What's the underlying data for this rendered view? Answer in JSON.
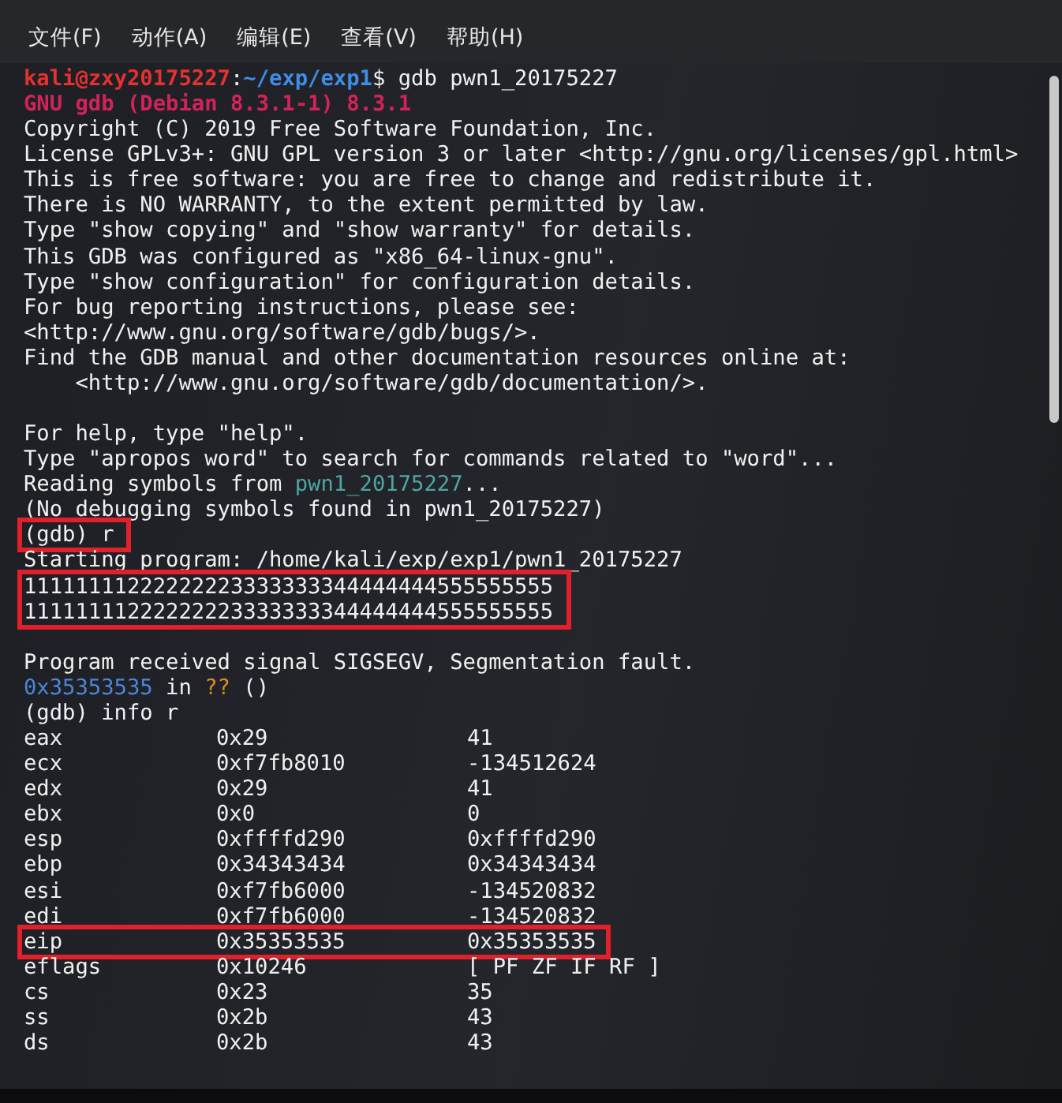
{
  "menu_bar": [
    {
      "label": "文件(F)"
    },
    {
      "label": "动作(A)"
    },
    {
      "label": "编辑(E)"
    },
    {
      "label": "查看(V)"
    },
    {
      "label": "帮助(H)"
    }
  ],
  "terminal": {
    "lines": [
      {
        "kind": "text",
        "segments": [
          {
            "kind": "user",
            "text": "kali@zxy20175227"
          },
          {
            "kind": "plain",
            "text": ":"
          },
          {
            "kind": "path",
            "text": "~/exp/exp1"
          },
          {
            "kind": "plain",
            "text": "$ gdb pwn1_20175227"
          }
        ]
      },
      {
        "kind": "text",
        "segments": [
          {
            "kind": "banner",
            "text": "GNU gdb (Debian 8.3.1-1) 8.3.1"
          }
        ]
      },
      {
        "kind": "text",
        "segments": [
          {
            "kind": "plain",
            "text": "Copyright (C) 2019 Free Software Foundation, Inc."
          }
        ]
      },
      {
        "kind": "text",
        "segments": [
          {
            "kind": "plain",
            "text": "License GPLv3+: GNU GPL version 3 or later <http://gnu.org/licenses/gpl.html>"
          }
        ]
      },
      {
        "kind": "text",
        "segments": [
          {
            "kind": "plain",
            "text": "This is free software: you are free to change and redistribute it."
          }
        ]
      },
      {
        "kind": "text",
        "segments": [
          {
            "kind": "plain",
            "text": "There is NO WARRANTY, to the extent permitted by law."
          }
        ]
      },
      {
        "kind": "text",
        "segments": [
          {
            "kind": "plain",
            "text": "Type \"show copying\" and \"show warranty\" for details."
          }
        ]
      },
      {
        "kind": "text",
        "segments": [
          {
            "kind": "plain",
            "text": "This GDB was configured as \"x86_64-linux-gnu\"."
          }
        ]
      },
      {
        "kind": "text",
        "segments": [
          {
            "kind": "plain",
            "text": "Type \"show configuration\" for configuration details."
          }
        ]
      },
      {
        "kind": "text",
        "segments": [
          {
            "kind": "plain",
            "text": "For bug reporting instructions, please see:"
          }
        ]
      },
      {
        "kind": "text",
        "segments": [
          {
            "kind": "plain",
            "text": "<http://www.gnu.org/software/gdb/bugs/>."
          }
        ]
      },
      {
        "kind": "text",
        "segments": [
          {
            "kind": "plain",
            "text": "Find the GDB manual and other documentation resources online at:"
          }
        ]
      },
      {
        "kind": "text",
        "segments": [
          {
            "kind": "plain",
            "text": "    <http://www.gnu.org/software/gdb/documentation/>."
          }
        ]
      },
      {
        "kind": "blank"
      },
      {
        "kind": "text",
        "segments": [
          {
            "kind": "plain",
            "text": "For help, type \"help\"."
          }
        ]
      },
      {
        "kind": "text",
        "segments": [
          {
            "kind": "plain",
            "text": "Type \"apropos word\" to search for commands related to \"word\"..."
          }
        ]
      },
      {
        "kind": "text",
        "segments": [
          {
            "kind": "plain",
            "text": "Reading symbols from "
          },
          {
            "kind": "file",
            "text": "pwn1_20175227"
          },
          {
            "kind": "plain",
            "text": "..."
          }
        ]
      },
      {
        "kind": "text",
        "segments": [
          {
            "kind": "plain",
            "text": "(No debugging symbols found in pwn1_20175227)"
          }
        ]
      },
      {
        "kind": "text",
        "boxed": true,
        "segments": [
          {
            "kind": "plain",
            "text": "(gdb) r"
          }
        ]
      },
      {
        "kind": "text",
        "segments": [
          {
            "kind": "plain",
            "text": "Starting program: /home/kali/exp/exp1/pwn1_20175227"
          }
        ]
      },
      {
        "kind": "text",
        "boxed": true,
        "segments": [
          {
            "kind": "plain",
            "text": "11111111222222223333333344444444555555555"
          }
        ]
      },
      {
        "kind": "text",
        "boxed": true,
        "segments": [
          {
            "kind": "plain",
            "text": "11111111222222223333333344444444555555555"
          }
        ]
      },
      {
        "kind": "blank"
      },
      {
        "kind": "text",
        "segments": [
          {
            "kind": "plain",
            "text": "Program received signal SIGSEGV, Segmentation fault."
          }
        ]
      },
      {
        "kind": "text",
        "segments": [
          {
            "kind": "address",
            "text": "0x35353535"
          },
          {
            "kind": "plain",
            "text": " in "
          },
          {
            "kind": "unknown",
            "text": "??"
          },
          {
            "kind": "plain",
            "text": " ()"
          }
        ]
      },
      {
        "kind": "text",
        "segments": [
          {
            "kind": "plain",
            "text": "(gdb) info r"
          }
        ]
      },
      {
        "kind": "register",
        "name": "eax",
        "hex": "0x29",
        "natural": "41"
      },
      {
        "kind": "register",
        "name": "ecx",
        "hex": "0xf7fb8010",
        "natural": "-134512624"
      },
      {
        "kind": "register",
        "name": "edx",
        "hex": "0x29",
        "natural": "41"
      },
      {
        "kind": "register",
        "name": "ebx",
        "hex": "0x0",
        "natural": "0"
      },
      {
        "kind": "register",
        "name": "esp",
        "hex": "0xffffd290",
        "natural": "0xffffd290"
      },
      {
        "kind": "register",
        "name": "ebp",
        "hex": "0x34343434",
        "natural": "0x34343434"
      },
      {
        "kind": "register",
        "name": "esi",
        "hex": "0xf7fb6000",
        "natural": "-134520832"
      },
      {
        "kind": "register",
        "name": "edi",
        "hex": "0xf7fb6000",
        "natural": "-134520832"
      },
      {
        "kind": "register",
        "boxed": true,
        "name": "eip",
        "hex": "0x35353535",
        "natural": "0x35353535"
      },
      {
        "kind": "register",
        "name": "eflags",
        "hex": "0x10246",
        "natural": "[ PF ZF IF RF ]"
      },
      {
        "kind": "register",
        "name": "cs",
        "hex": "0x23",
        "natural": "35"
      },
      {
        "kind": "register",
        "name": "ss",
        "hex": "0x2b",
        "natural": "43"
      },
      {
        "kind": "register",
        "name": "ds",
        "hex": "0x2b",
        "natural": "43"
      }
    ]
  }
}
